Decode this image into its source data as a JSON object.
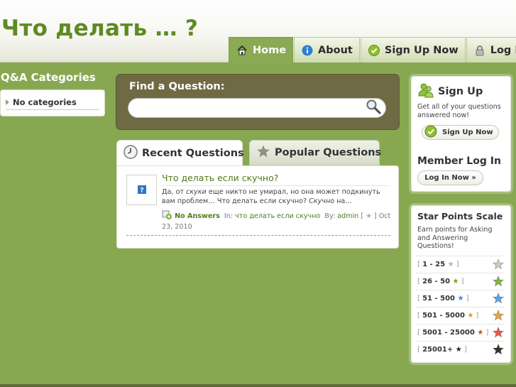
{
  "site": {
    "title": "Что делать … ?"
  },
  "nav": {
    "items": [
      {
        "label": "Home",
        "icon": "home-icon"
      },
      {
        "label": "About",
        "icon": "info-icon"
      },
      {
        "label": "Sign Up Now",
        "icon": "check-icon"
      },
      {
        "label": "Log In",
        "icon": "lock-icon"
      }
    ]
  },
  "categories": {
    "title": "Q&A Categories",
    "empty_label": "No categories"
  },
  "search": {
    "label": "Find a Question:",
    "placeholder": "",
    "value": ""
  },
  "tabs": {
    "recent": "Recent Questions",
    "popular": "Popular Questions"
  },
  "question": {
    "title": "Что делать если скучно?",
    "excerpt_1": "Да, от ",
    "excerpt_em1": "скуки",
    "excerpt_2": " еще никто не умирал, но она может подкинуть вам проблем… Что делать если скучно? ",
    "excerpt_em2": "Скучно",
    "excerpt_3": " на…",
    "answers": "No Answers",
    "in_label": "In:",
    "category": "что делать если скучно",
    "by_label": "By:",
    "author": "admin",
    "rating_open": "[",
    "rating_star": "★",
    "rating_close": "]",
    "date": "Oct 23, 2010"
  },
  "signup": {
    "title": "Sign Up",
    "text": "Get all of your questions answered now!",
    "button": "Sign Up Now"
  },
  "login": {
    "title": "Member Log In",
    "button": "Log In Now »"
  },
  "star_points": {
    "title": "Star Points Scale",
    "text": "Earn points for Asking and Answering Questions!",
    "levels": [
      {
        "range": "1 - 25",
        "star_color": "#b5b5a8",
        "icon_color": "#c9cbb8"
      },
      {
        "range": "26 - 50",
        "star_color": "#6fa52b",
        "icon_color": "#7fb24a"
      },
      {
        "range": "51 - 500",
        "star_color": "#3a86c8",
        "icon_color": "#5aa2da"
      },
      {
        "range": "501 - 5000",
        "star_color": "#d49a1c",
        "icon_color": "#e0a548"
      },
      {
        "range": "5001 - 25000",
        "star_color": "#d8442c",
        "icon_color": "#e05b52"
      },
      {
        "range": "25001+",
        "star_color": "#222222",
        "icon_color": "#333333"
      }
    ]
  },
  "colors": {
    "brand_green": "#5e8a24",
    "background": "#87a851",
    "search_panel": "#6f6a43"
  }
}
